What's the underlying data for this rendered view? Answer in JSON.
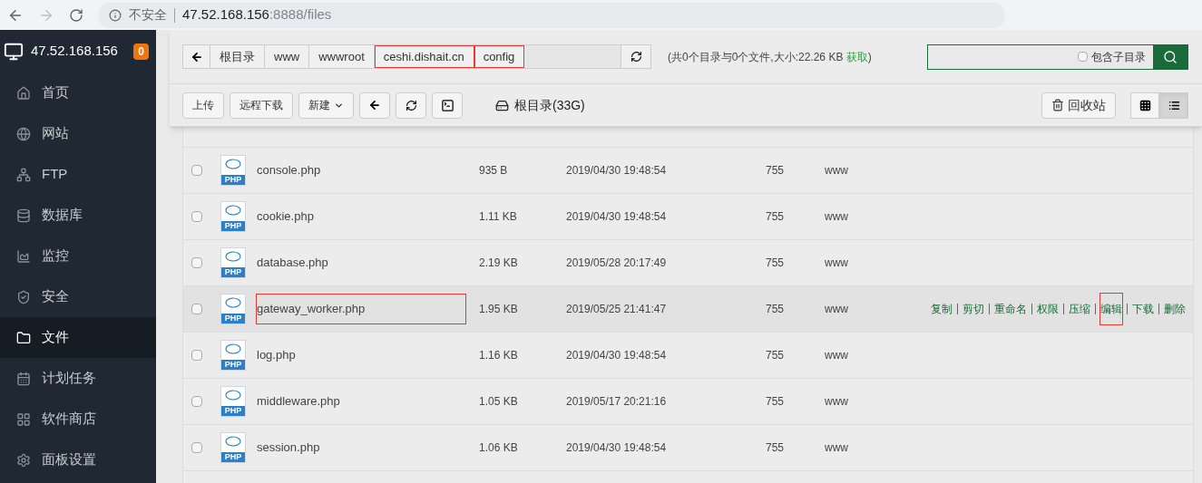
{
  "browser": {
    "security": "不安全",
    "host": "47.52.168.156",
    "path": ":8888/files",
    "forward_disabled": true
  },
  "sidebar": {
    "server": "47.52.168.156",
    "badge": "0",
    "items": [
      {
        "label": "首页",
        "selected": false
      },
      {
        "label": "网站",
        "selected": false
      },
      {
        "label": "FTP",
        "selected": false
      },
      {
        "label": "数据库",
        "selected": false
      },
      {
        "label": "监控",
        "selected": false
      },
      {
        "label": "安全",
        "selected": false
      },
      {
        "label": "文件",
        "selected": true
      },
      {
        "label": "计划任务",
        "selected": false
      },
      {
        "label": "软件商店",
        "selected": false
      },
      {
        "label": "面板设置",
        "selected": false
      }
    ]
  },
  "breadcrumb": [
    {
      "label": "根目录",
      "highlighted": false
    },
    {
      "label": "www",
      "highlighted": false
    },
    {
      "label": "wwwroot",
      "highlighted": false
    },
    {
      "label": "ceshi.dishait.cn",
      "highlighted": true
    },
    {
      "label": "config",
      "highlighted": true
    }
  ],
  "summary": {
    "text": "(共0个目录与0个文件,大小:22.26 KB",
    "link": "获取",
    "close": ")"
  },
  "search": {
    "subdir_label": "包含子目录",
    "subdir_checked": false
  },
  "toolbar": {
    "buttons": [
      {
        "label": "上传",
        "kind": "text"
      },
      {
        "label": "远程下载",
        "kind": "text"
      },
      {
        "label": "新建",
        "kind": "dropdown"
      }
    ],
    "disk": "根目录(33G)",
    "recycle": "回收站",
    "views": [
      {
        "kind": "grid",
        "selected": false
      },
      {
        "kind": "list",
        "selected": true
      }
    ]
  },
  "files": [
    {
      "icon_label": "PHP",
      "name": "console.php",
      "size": "935 B",
      "date": "2019/04/30 19:48:54",
      "perm": "755",
      "owner": "www",
      "hovered": false,
      "highlighted": false
    },
    {
      "icon_label": "PHP",
      "name": "cookie.php",
      "size": "1.11 KB",
      "date": "2019/04/30 19:48:54",
      "perm": "755",
      "owner": "www",
      "hovered": false,
      "highlighted": false
    },
    {
      "icon_label": "PHP",
      "name": "database.php",
      "size": "2.19 KB",
      "date": "2019/05/28 20:17:49",
      "perm": "755",
      "owner": "www",
      "hovered": false,
      "highlighted": false
    },
    {
      "icon_label": "PHP",
      "name": "gateway_worker.php",
      "size": "1.95 KB",
      "date": "2019/05/25 21:41:47",
      "perm": "755",
      "owner": "www",
      "hovered": true,
      "highlighted": true
    },
    {
      "icon_label": "PHP",
      "name": "log.php",
      "size": "1.16 KB",
      "date": "2019/04/30 19:48:54",
      "perm": "755",
      "owner": "www",
      "hovered": false,
      "highlighted": false
    },
    {
      "icon_label": "PHP",
      "name": "middleware.php",
      "size": "1.05 KB",
      "date": "2019/05/17 20:21:16",
      "perm": "755",
      "owner": "www",
      "hovered": false,
      "highlighted": false
    },
    {
      "icon_label": "PHP",
      "name": "session.php",
      "size": "1.06 KB",
      "date": "2019/04/30 19:48:54",
      "perm": "755",
      "owner": "www",
      "hovered": false,
      "highlighted": false
    }
  ],
  "row_actions": [
    {
      "label": "复制",
      "highlighted": false
    },
    {
      "label": "剪切",
      "highlighted": false
    },
    {
      "label": "重命名",
      "highlighted": false
    },
    {
      "label": "权限",
      "highlighted": false
    },
    {
      "label": "压缩",
      "highlighted": false
    },
    {
      "label": "编辑",
      "highlighted": true
    },
    {
      "label": "下载",
      "highlighted": false
    },
    {
      "label": "删除",
      "highlighted": false
    }
  ]
}
